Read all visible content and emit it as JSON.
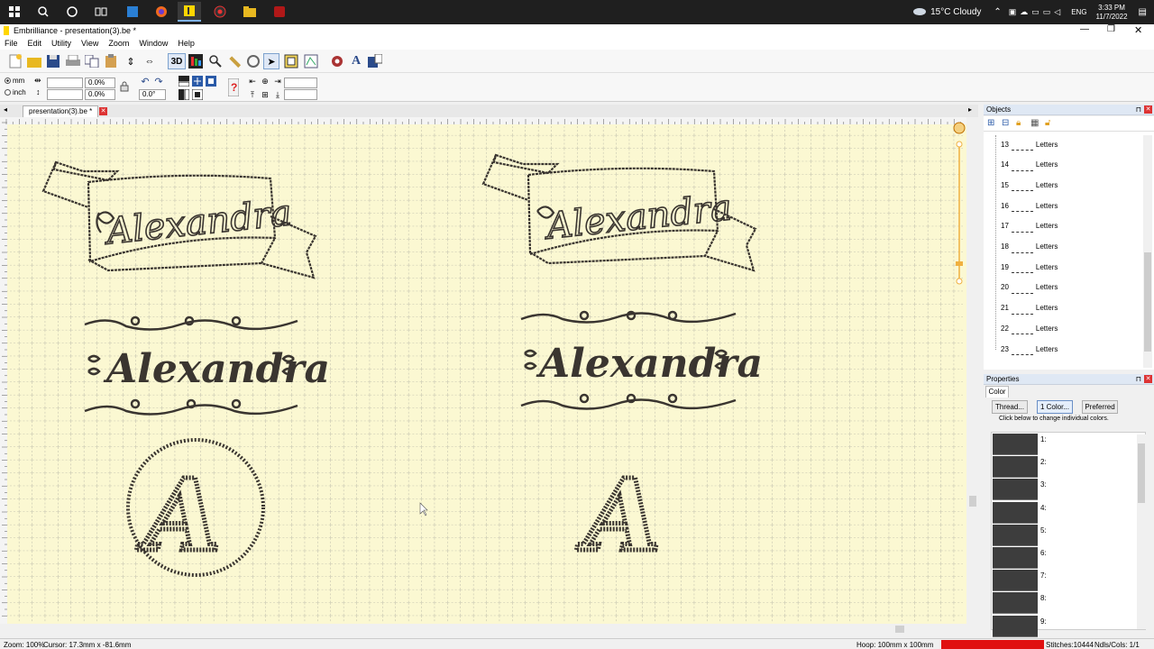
{
  "taskbar": {
    "weather": "15°C  Cloudy",
    "lang": "ENG",
    "time": "3:33 PM",
    "date": "11/7/2022"
  },
  "window": {
    "title": "Embrilliance - presentation(3).be *"
  },
  "menu": [
    "File",
    "Edit",
    "Utility",
    "View",
    "Zoom",
    "Window",
    "Help"
  ],
  "toolbar": {
    "three_d_label": "3D",
    "units": {
      "mm": "mm",
      "inch": "inch"
    },
    "rotate_value": "0.0°",
    "width_pct": "0.0%",
    "height_pct": "0.0%"
  },
  "document": {
    "tab_label": "presentation(3).be *"
  },
  "designs": {
    "banner_name": "Alexandra",
    "bold_name": "Alexandra",
    "monogram_letter": "A"
  },
  "objects_panel": {
    "title": "Objects",
    "items": [
      {
        "num": "13",
        "label": "Letters"
      },
      {
        "num": "14",
        "label": "Letters"
      },
      {
        "num": "15",
        "label": "Letters"
      },
      {
        "num": "16",
        "label": "Letters"
      },
      {
        "num": "17",
        "label": "Letters"
      },
      {
        "num": "18",
        "label": "Letters"
      },
      {
        "num": "19",
        "label": "Letters"
      },
      {
        "num": "20",
        "label": "Letters"
      },
      {
        "num": "21",
        "label": "Letters"
      },
      {
        "num": "22",
        "label": "Letters"
      },
      {
        "num": "23",
        "label": "Letters"
      }
    ]
  },
  "properties_panel": {
    "title": "Properties",
    "tab": "Color",
    "thread_btn": "Thread...",
    "color_btn": "1 Color...",
    "preferred_btn": "Preferred",
    "hint": "Click below to change individual colors.",
    "colors": [
      "1:",
      "2:",
      "3:",
      "4:",
      "5:",
      "6:",
      "7:",
      "8:",
      "9:"
    ],
    "swatch_color": "#3d3d3d"
  },
  "status": {
    "zoom": "Zoom: 100%",
    "cursor": "Cursor: 17.3mm x -81.6mm",
    "hoop": "Hoop: 100mm x 100mm",
    "stitches": "Stitches:10444",
    "ndls": "Ndls/Cols: 1/1"
  },
  "colors": {
    "canvas": "#fbf8d2",
    "stitch": "#3a3530",
    "status_alert": "#e01010"
  }
}
